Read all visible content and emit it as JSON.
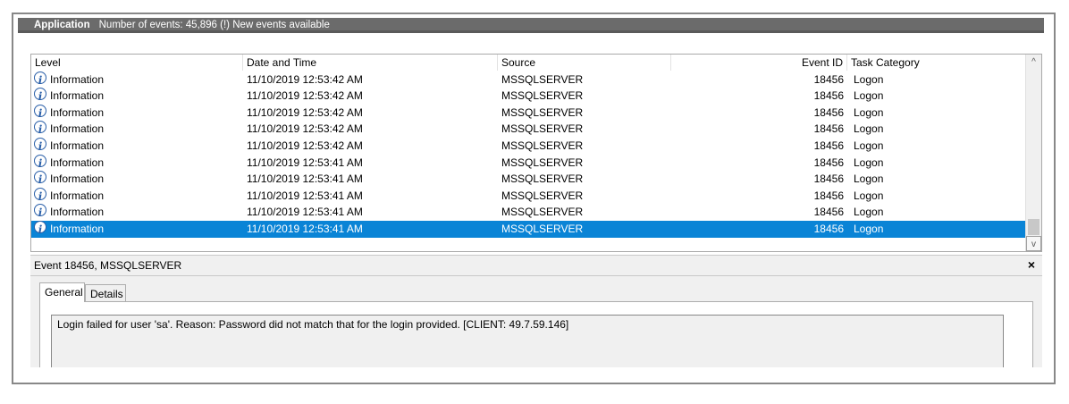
{
  "header": {
    "log_name": "Application",
    "status_text": "Number of events: 45,896 (!) New events available"
  },
  "columns": {
    "level": "Level",
    "datetime": "Date and Time",
    "source": "Source",
    "event_id": "Event ID",
    "task_category": "Task Category"
  },
  "rows": [
    {
      "level": "Information",
      "datetime": "11/10/2019 12:53:42 AM",
      "source": "MSSQLSERVER",
      "event_id": "18456",
      "task": "Logon",
      "selected": false
    },
    {
      "level": "Information",
      "datetime": "11/10/2019 12:53:42 AM",
      "source": "MSSQLSERVER",
      "event_id": "18456",
      "task": "Logon",
      "selected": false
    },
    {
      "level": "Information",
      "datetime": "11/10/2019 12:53:42 AM",
      "source": "MSSQLSERVER",
      "event_id": "18456",
      "task": "Logon",
      "selected": false
    },
    {
      "level": "Information",
      "datetime": "11/10/2019 12:53:42 AM",
      "source": "MSSQLSERVER",
      "event_id": "18456",
      "task": "Logon",
      "selected": false
    },
    {
      "level": "Information",
      "datetime": "11/10/2019 12:53:42 AM",
      "source": "MSSQLSERVER",
      "event_id": "18456",
      "task": "Logon",
      "selected": false
    },
    {
      "level": "Information",
      "datetime": "11/10/2019 12:53:41 AM",
      "source": "MSSQLSERVER",
      "event_id": "18456",
      "task": "Logon",
      "selected": false
    },
    {
      "level": "Information",
      "datetime": "11/10/2019 12:53:41 AM",
      "source": "MSSQLSERVER",
      "event_id": "18456",
      "task": "Logon",
      "selected": false
    },
    {
      "level": "Information",
      "datetime": "11/10/2019 12:53:41 AM",
      "source": "MSSQLSERVER",
      "event_id": "18456",
      "task": "Logon",
      "selected": false
    },
    {
      "level": "Information",
      "datetime": "11/10/2019 12:53:41 AM",
      "source": "MSSQLSERVER",
      "event_id": "18456",
      "task": "Logon",
      "selected": false
    },
    {
      "level": "Information",
      "datetime": "11/10/2019 12:53:41 AM",
      "source": "MSSQLSERVER",
      "event_id": "18456",
      "task": "Logon",
      "selected": true
    }
  ],
  "icons": {
    "level": "information-icon",
    "scroll_up": "chevron-up-icon",
    "scroll_down": "chevron-down-icon",
    "close": "close-icon"
  },
  "detail": {
    "title": "Event 18456, MSSQLSERVER",
    "close_glyph": "×",
    "tabs": [
      "General",
      "Details"
    ],
    "active_tab": "General",
    "message": "Login failed for user 'sa'. Reason: Password did not match that for the login provided. [CLIENT: 49.7.59.146]"
  },
  "colors": {
    "selection": "#0a84d6",
    "title_bar": "#6b6b6b",
    "info_icon": "#2a5fa8"
  }
}
